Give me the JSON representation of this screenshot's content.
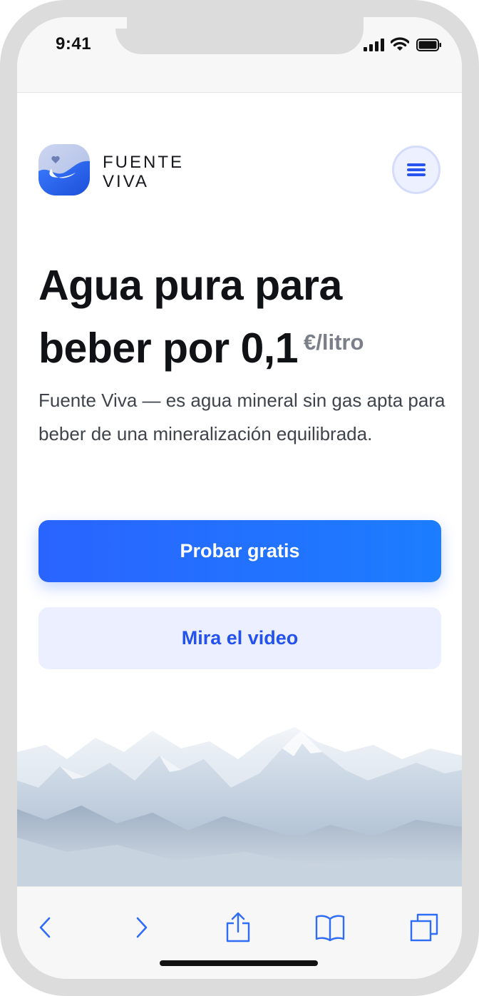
{
  "status_bar": {
    "time": "9:41"
  },
  "brand": {
    "line1": "FUENTE",
    "line2": "VIVA"
  },
  "hero": {
    "headline_line1": "Agua pura para",
    "headline_line2": "beber por 0,1",
    "price_unit": "€/litro",
    "description": "Fuente Viva — es agua mineral  sin gas apta para beber de una mineralización equilibrada."
  },
  "buttons": {
    "primary": "Probar gratis",
    "secondary": "Mira el video"
  },
  "toolbar": {
    "icons": [
      "back-icon",
      "forward-icon",
      "share-icon",
      "bookmarks-icon",
      "tabs-icon"
    ]
  },
  "colors": {
    "accent": "#2a64ff",
    "secondary_bg": "#ebefff",
    "text": "#101216",
    "muted": "#7a7f89"
  }
}
